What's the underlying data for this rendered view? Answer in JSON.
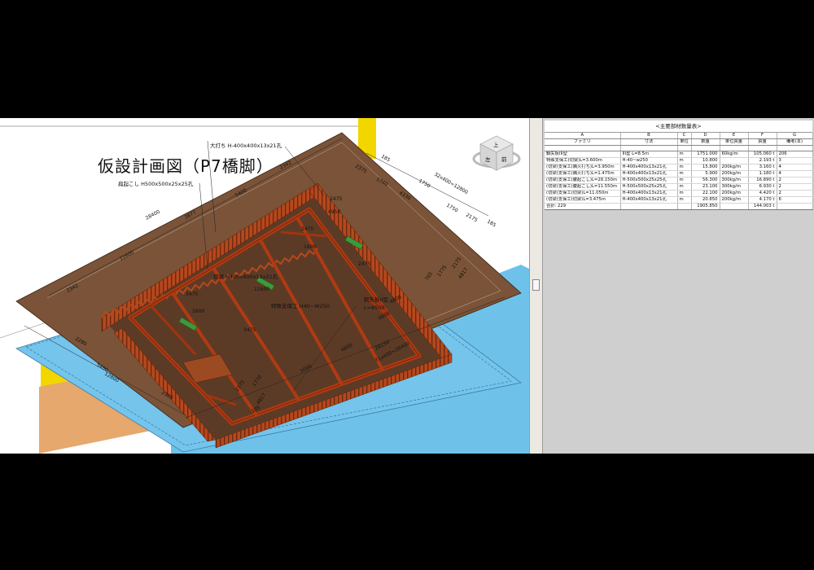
{
  "plan_title": "仮設計画図（P7橋脚）",
  "labels": {
    "top_beam": "大打ち H-400x400x13x21孔",
    "jack_beam": "扁起こし H500x500x25x25孔",
    "tie_beam": "切梁 H400x400x13x21孔",
    "special_beam": "特殊支保工 H40~W250",
    "sheet_pile": "鋼矢板II型",
    "pile_len": "L=8500"
  },
  "dimensions": {
    "d_185_top": "185",
    "d_32x400": "32x400=12800",
    "d_2375": "2375",
    "d_1760": "1760",
    "d_4330": "4330",
    "d_1750": "1750",
    "d_2175a": "2175",
    "d_185_right": "185",
    "d_2342a": "2342",
    "d_5400a": "5400",
    "d_28400a": "28400",
    "d_3877": "3877",
    "d_11600": "11600",
    "d_2342b": "2342",
    "d_2475a": "2475",
    "d_4950": "4950",
    "d_2475b": "2475",
    "d_2475c": "2475",
    "d_1600a": "1600",
    "d_11600b": "11600",
    "d_3475a": "3475",
    "d_1600b": "1600",
    "d_3475b": "3475",
    "d_2175b": "2175",
    "d_4817a": "4817",
    "d_765": "765",
    "d_1775": "1775",
    "d_4800": "4800",
    "d_2280": "2280",
    "d_5400b": "5400",
    "d_12800": "12800",
    "d_2380": "2380",
    "d_2175c": "2175",
    "d_1770": "1770",
    "d_4817b": "4817",
    "d_5000": "5000",
    "d_4800b": "4800",
    "d_28150": "28150",
    "d_71x400": "71x400=28400",
    "d_185_bottom": "185"
  },
  "viewcube": {
    "face_top": "上",
    "face_front": "前",
    "face_left": "左"
  },
  "schedule": {
    "title": "<主要部材数量表>",
    "letters": [
      "A",
      "B",
      "C",
      "D",
      "E",
      "F",
      "G"
    ],
    "headers": [
      "ファミリ",
      "寸法",
      "単位",
      "数量",
      "単位質量",
      "質量",
      "備考(本)"
    ],
    "rows": [
      [
        "鋼矢板III型",
        "III型 L=8.5m",
        "m",
        "1751.000",
        "60kg/m",
        "105.060 t",
        "206"
      ],
      [
        "特殊支保工(切梁)L=3.600m",
        "H-40~w250",
        "m",
        "10.800",
        "",
        "2.193 t",
        "3"
      ],
      [
        "(切梁)支保工(隅火打ち)L=3.950m",
        "H-400x400x13x21孔",
        "m",
        "15.800",
        "200kg/m",
        "3.160 t",
        "4"
      ],
      [
        "(切梁)支保工(隅火打ち)L=1.475m",
        "H-400x400x13x21孔",
        "m",
        "5.900",
        "200kg/m",
        "1.180 t",
        "4"
      ],
      [
        "(切梁)支保工(腹起こし)L=28.150m",
        "H-500x500x25x25孔",
        "m",
        "56.300",
        "300kg/m",
        "16.890 t",
        "2"
      ],
      [
        "(切梁)支保工(腹起こし)L=11.550m",
        "H-500x500x25x25孔",
        "m",
        "23.100",
        "300kg/m",
        "6.930 t",
        "2"
      ],
      [
        "(切梁)支保工(切梁)L=11.050m",
        "H-400x400x13x21孔",
        "m",
        "22.100",
        "200kg/m",
        "4.420 t",
        "2"
      ],
      [
        "(切梁)支保工(切梁)L=3.475m",
        "H-400x400x13x21孔",
        "m",
        "20.850",
        "200kg/m",
        "4.170 t",
        "6"
      ]
    ],
    "total": [
      "合計: 229",
      "",
      "",
      "1905.850",
      "",
      "144.003 t",
      ""
    ]
  },
  "colors": {
    "ground_brown": "#7a5338",
    "sheet_pile": "#a0401a",
    "water_blue": "#6ec2ea",
    "yellow": "#f2d600",
    "sand": "#e6a86c"
  }
}
